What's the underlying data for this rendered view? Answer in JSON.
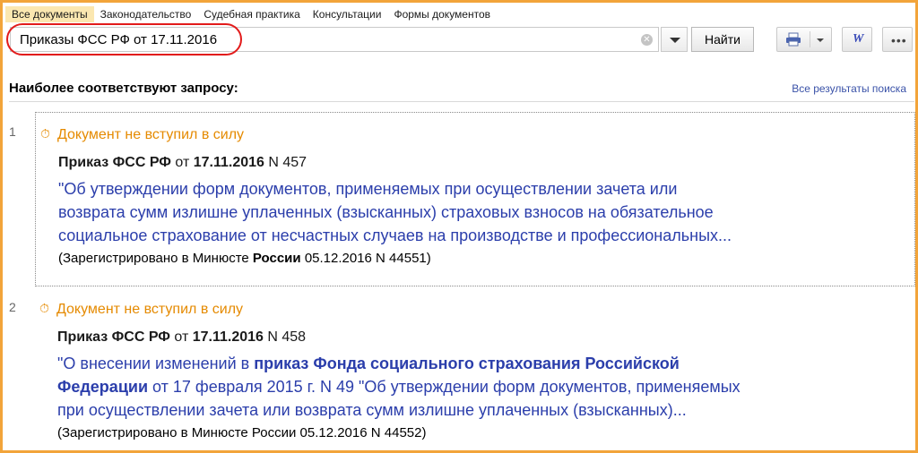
{
  "tabs": [
    {
      "label": "Все документы",
      "active": true
    },
    {
      "label": "Законодательство",
      "active": false
    },
    {
      "label": "Судебная практика",
      "active": false
    },
    {
      "label": "Консультации",
      "active": false
    },
    {
      "label": "Формы документов",
      "active": false
    }
  ],
  "search": {
    "value": "Приказы ФСС РФ от 17.11.2016",
    "clear_icon": "clear-icon",
    "find_label": "Найти"
  },
  "toolbar": {
    "print_icon": "printer-icon",
    "word_label": "W",
    "more_label": "•••"
  },
  "results_header": {
    "title": "Наиболее соответствуют запросу:",
    "all_results": "Все результаты поиска"
  },
  "results": [
    {
      "number": "1",
      "status": "Документ не вступил в силу",
      "doc_type": "Приказ ФСС РФ",
      "date_prefix": "от",
      "date": "17.11.2016",
      "doc_number": "N 457",
      "desc_line1": "\"Об утверждении форм документов, применяемых при осуществлении зачета или",
      "desc_line2": "возврата сумм излишне уплаченных (взысканных) страховых взносов на обязательное",
      "desc_line3": "социальное страхование от несчастных случаев на производстве и профессиональных...",
      "reg_prefix": "(Зарегистрировано в Минюсте",
      "reg_bold": "России",
      "reg_suffix": "05.12.2016 N 44551)"
    },
    {
      "number": "2",
      "status": "Документ не вступил в силу",
      "doc_type": "Приказ ФСС РФ",
      "date_prefix": "от",
      "date": "17.11.2016",
      "doc_number": "N 458",
      "desc_line1_a": "\"О внесении изменений в",
      "desc_line1_b": "приказ Фонда социального страхования Российской",
      "desc_line2_a": "Федерации",
      "desc_line2_b": "от 17 февраля 2015 г. N 49 \"Об утверждении форм документов, применяемых",
      "desc_line3": "при осуществлении зачета или возврата сумм излишне уплаченных (взысканных)...",
      "reg": "(Зарегистрировано в Минюсте России 05.12.2016 N 44552)"
    }
  ]
}
